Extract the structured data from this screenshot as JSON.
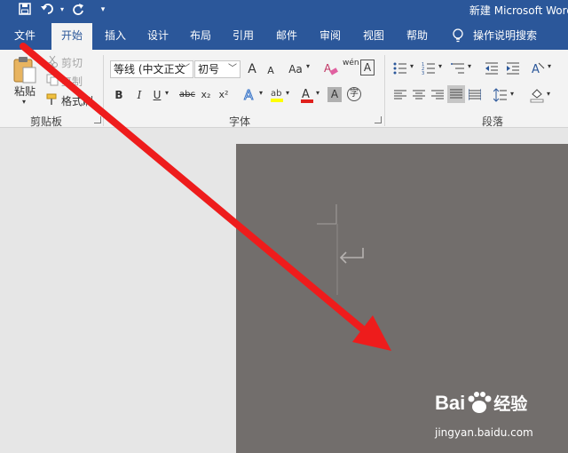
{
  "window": {
    "title": "新建 Microsoft Word"
  },
  "tabs": [
    {
      "label": "文件"
    },
    {
      "label": "开始"
    },
    {
      "label": "插入"
    },
    {
      "label": "设计"
    },
    {
      "label": "布局"
    },
    {
      "label": "引用"
    },
    {
      "label": "邮件"
    },
    {
      "label": "审阅"
    },
    {
      "label": "视图"
    },
    {
      "label": "帮助"
    }
  ],
  "tell_me": "操作说明搜索",
  "clipboard": {
    "paste": "粘贴",
    "cut": "剪切",
    "copy": "复制",
    "format_painter": "格式刷",
    "group_label": "剪贴板"
  },
  "font": {
    "name": "等线 (中文正文",
    "size": "初号",
    "grow": "A",
    "shrink": "A",
    "case": "Aa",
    "bold": "B",
    "italic": "I",
    "underline": "U",
    "strike": "abc",
    "subscript": "x₂",
    "superscript": "x²",
    "phonetic": "wén",
    "char_border": "A",
    "enclose": "字",
    "group_label": "字体"
  },
  "paragraph": {
    "group_label": "段落"
  },
  "watermark": {
    "logo": "Bai",
    "logo_suffix": "经验",
    "url": "jingyan.baidu.com"
  },
  "colors": {
    "accent": "#2b579a",
    "page": "#726e6c",
    "arrow": "#ee1c1c"
  }
}
